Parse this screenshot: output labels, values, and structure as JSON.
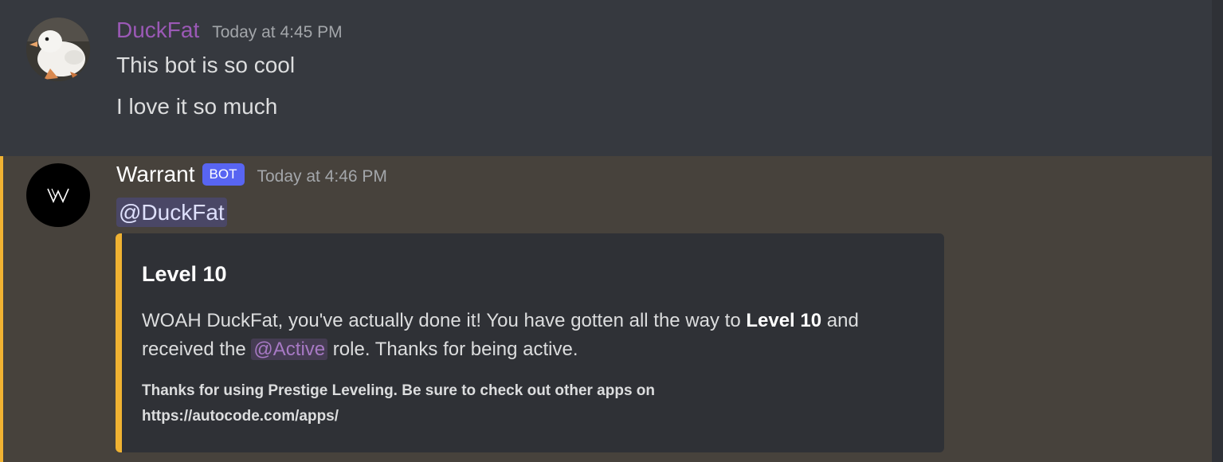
{
  "messages": [
    {
      "author": "DuckFat",
      "timestamp": "Today at 4:45 PM",
      "author_color": "#9b59b6",
      "avatar_icon": "duck-avatar-icon",
      "lines": [
        "This bot is so cool",
        "I love it so much"
      ]
    },
    {
      "author": "Warrant",
      "bot_tag": "BOT",
      "timestamp": "Today at 4:46 PM",
      "author_color": "#ffffff",
      "avatar_icon": "warrant-logo-icon",
      "mention": "@DuckFat",
      "embed": {
        "accent_color": "#f0b232",
        "title": "Level 10",
        "description_parts": [
          "WOAH DuckFat, you've actually done it! You have gotten all the way to ",
          "Level 10",
          " and received the ",
          "@Active",
          " role. Thanks for being active."
        ],
        "footer_line1": "Thanks for using Prestige Leveling. Be sure to check out other apps on",
        "footer_line2": "https://autocode.com/apps/"
      }
    }
  ],
  "colors": {
    "background": "#36393f",
    "highlight_background": "#47423c",
    "highlight_bar": "#f0b232",
    "mention_background": "#4a4766",
    "bot_tag": "#5865f2",
    "role_color": "#a779c4"
  }
}
